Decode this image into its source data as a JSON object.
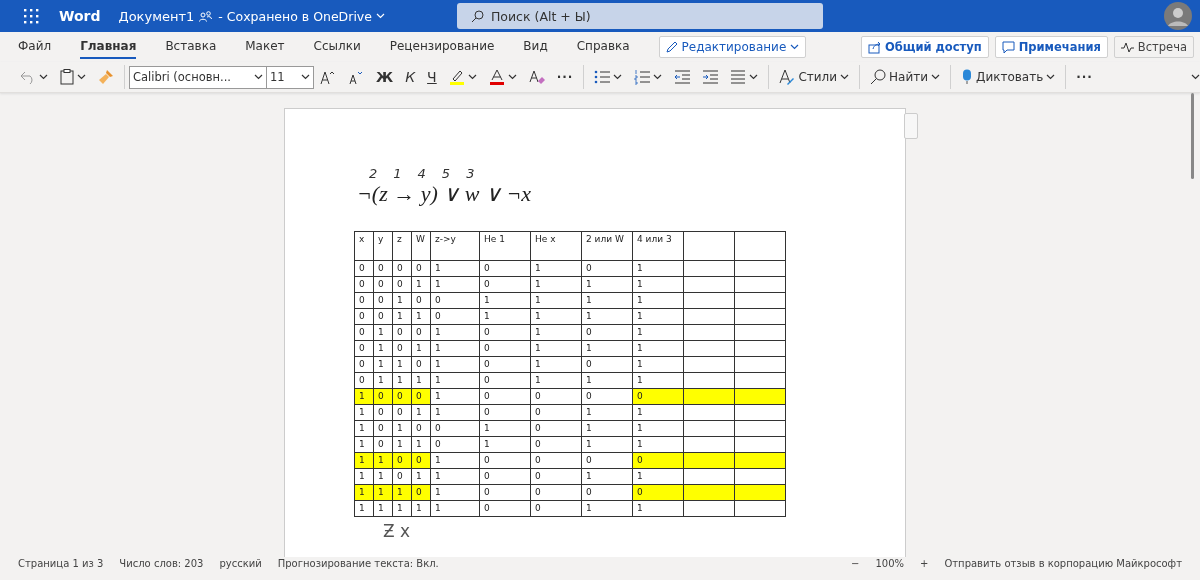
{
  "titlebar": {
    "app": "Word",
    "document": "Документ1",
    "save_status": "- Сохранено в OneDrive",
    "search": {
      "placeholder": "Поиск (Alt + Ы)"
    }
  },
  "tabs": [
    {
      "label": "Файл",
      "selected": false
    },
    {
      "label": "Главная",
      "selected": true
    },
    {
      "label": "Вставка",
      "selected": false
    },
    {
      "label": "Макет",
      "selected": false
    },
    {
      "label": "Ссылки",
      "selected": false
    },
    {
      "label": "Рецензирование",
      "selected": false
    },
    {
      "label": "Вид",
      "selected": false
    },
    {
      "label": "Справка",
      "selected": false
    }
  ],
  "mode_button": "Редактирование",
  "right_buttons": [
    {
      "label": "Общий доступ",
      "kind": "share"
    },
    {
      "label": "Примечания",
      "kind": "comments"
    },
    {
      "label": "Встреча",
      "kind": "meet"
    }
  ],
  "toolbar": {
    "font_name": "Calibri (основн...",
    "font_size": "11",
    "bold": "Ж",
    "italic": "К",
    "underline": "Ч",
    "more": "···",
    "styles": "Стили",
    "find": "Найти",
    "dictate": "Диктовать",
    "more_right": "···"
  },
  "document": {
    "formula": "¬(z → y) ∨ w ∨ ¬x",
    "annotations": [
      "2",
      "1",
      "4",
      "5",
      "3"
    ],
    "table": {
      "columns": [
        "x",
        "y",
        "z",
        "W",
        "z->y",
        "Не 1",
        "Не x",
        "2 или W",
        "4 или 3"
      ],
      "rows": [
        {
          "cells": [
            "0",
            "0",
            "0",
            "0",
            "1",
            "0",
            "1",
            "0",
            "1"
          ],
          "highlighted": false
        },
        {
          "cells": [
            "0",
            "0",
            "0",
            "1",
            "1",
            "0",
            "1",
            "1",
            "1"
          ],
          "highlighted": false
        },
        {
          "cells": [
            "0",
            "0",
            "1",
            "0",
            "0",
            "1",
            "1",
            "1",
            "1"
          ],
          "highlighted": false
        },
        {
          "cells": [
            "0",
            "0",
            "1",
            "1",
            "0",
            "1",
            "1",
            "1",
            "1"
          ],
          "highlighted": false
        },
        {
          "cells": [
            "0",
            "1",
            "0",
            "0",
            "1",
            "0",
            "1",
            "0",
            "1"
          ],
          "highlighted": false
        },
        {
          "cells": [
            "0",
            "1",
            "0",
            "1",
            "1",
            "0",
            "1",
            "1",
            "1"
          ],
          "highlighted": false
        },
        {
          "cells": [
            "0",
            "1",
            "1",
            "0",
            "1",
            "0",
            "1",
            "0",
            "1"
          ],
          "highlighted": false
        },
        {
          "cells": [
            "0",
            "1",
            "1",
            "1",
            "1",
            "0",
            "1",
            "1",
            "1"
          ],
          "highlighted": false
        },
        {
          "cells": [
            "1",
            "0",
            "0",
            "0",
            "1",
            "0",
            "0",
            "0",
            "0"
          ],
          "highlighted": true
        },
        {
          "cells": [
            "1",
            "0",
            "0",
            "1",
            "1",
            "0",
            "0",
            "1",
            "1"
          ],
          "highlighted": false
        },
        {
          "cells": [
            "1",
            "0",
            "1",
            "0",
            "0",
            "1",
            "0",
            "1",
            "1"
          ],
          "highlighted": false
        },
        {
          "cells": [
            "1",
            "0",
            "1",
            "1",
            "0",
            "1",
            "0",
            "1",
            "1"
          ],
          "highlighted": false
        },
        {
          "cells": [
            "1",
            "1",
            "0",
            "0",
            "1",
            "0",
            "0",
            "0",
            "0"
          ],
          "highlighted": true
        },
        {
          "cells": [
            "1",
            "1",
            "0",
            "1",
            "1",
            "0",
            "0",
            "1",
            "1"
          ],
          "highlighted": false
        },
        {
          "cells": [
            "1",
            "1",
            "1",
            "0",
            "1",
            "0",
            "0",
            "0",
            "0"
          ],
          "highlighted": true
        },
        {
          "cells": [
            "1",
            "1",
            "1",
            "1",
            "1",
            "0",
            "0",
            "1",
            "1"
          ],
          "highlighted": false
        }
      ]
    },
    "handwriting": "Ƶ x"
  },
  "status_bar": {
    "items": [
      "Страница 1 из 3",
      "Число слов: 203",
      "русский",
      "Прогнозирование текста: Вкл."
    ],
    "zoom_out": "−",
    "zoom": "100%",
    "zoom_in": "+",
    "feedback": "Отправить отзыв в корпорацию Майкрософт"
  }
}
